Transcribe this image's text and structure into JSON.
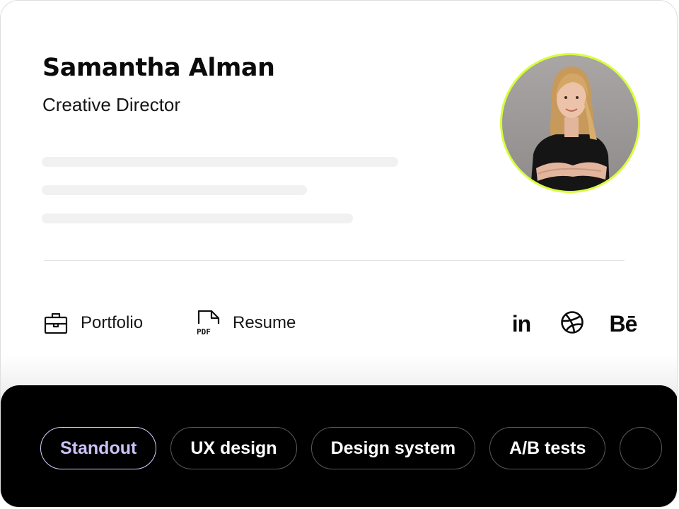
{
  "profile": {
    "name": "Samantha Alman",
    "role": "Creative Director"
  },
  "links": {
    "portfolio": {
      "label": "Portfolio",
      "icon": "briefcase-icon"
    },
    "resume": {
      "label": "Resume",
      "icon": "pdf-file-icon",
      "icon_text": "PDF"
    }
  },
  "social": {
    "linkedin": {
      "glyph": "in",
      "icon": "linkedin-icon"
    },
    "dribbble": {
      "icon": "dribbble-icon"
    },
    "behance": {
      "glyph": "Bē",
      "icon": "behance-icon"
    }
  },
  "tags": [
    {
      "label": "Standout",
      "active": true
    },
    {
      "label": "UX design",
      "active": false
    },
    {
      "label": "Design system",
      "active": false
    },
    {
      "label": "A/B tests",
      "active": false
    },
    {
      "label": "",
      "active": false
    }
  ],
  "colors": {
    "avatar_ring": "#d8ff3c",
    "active_tag_text": "#ccc0f7",
    "tag_bar_bg": "#000000"
  }
}
